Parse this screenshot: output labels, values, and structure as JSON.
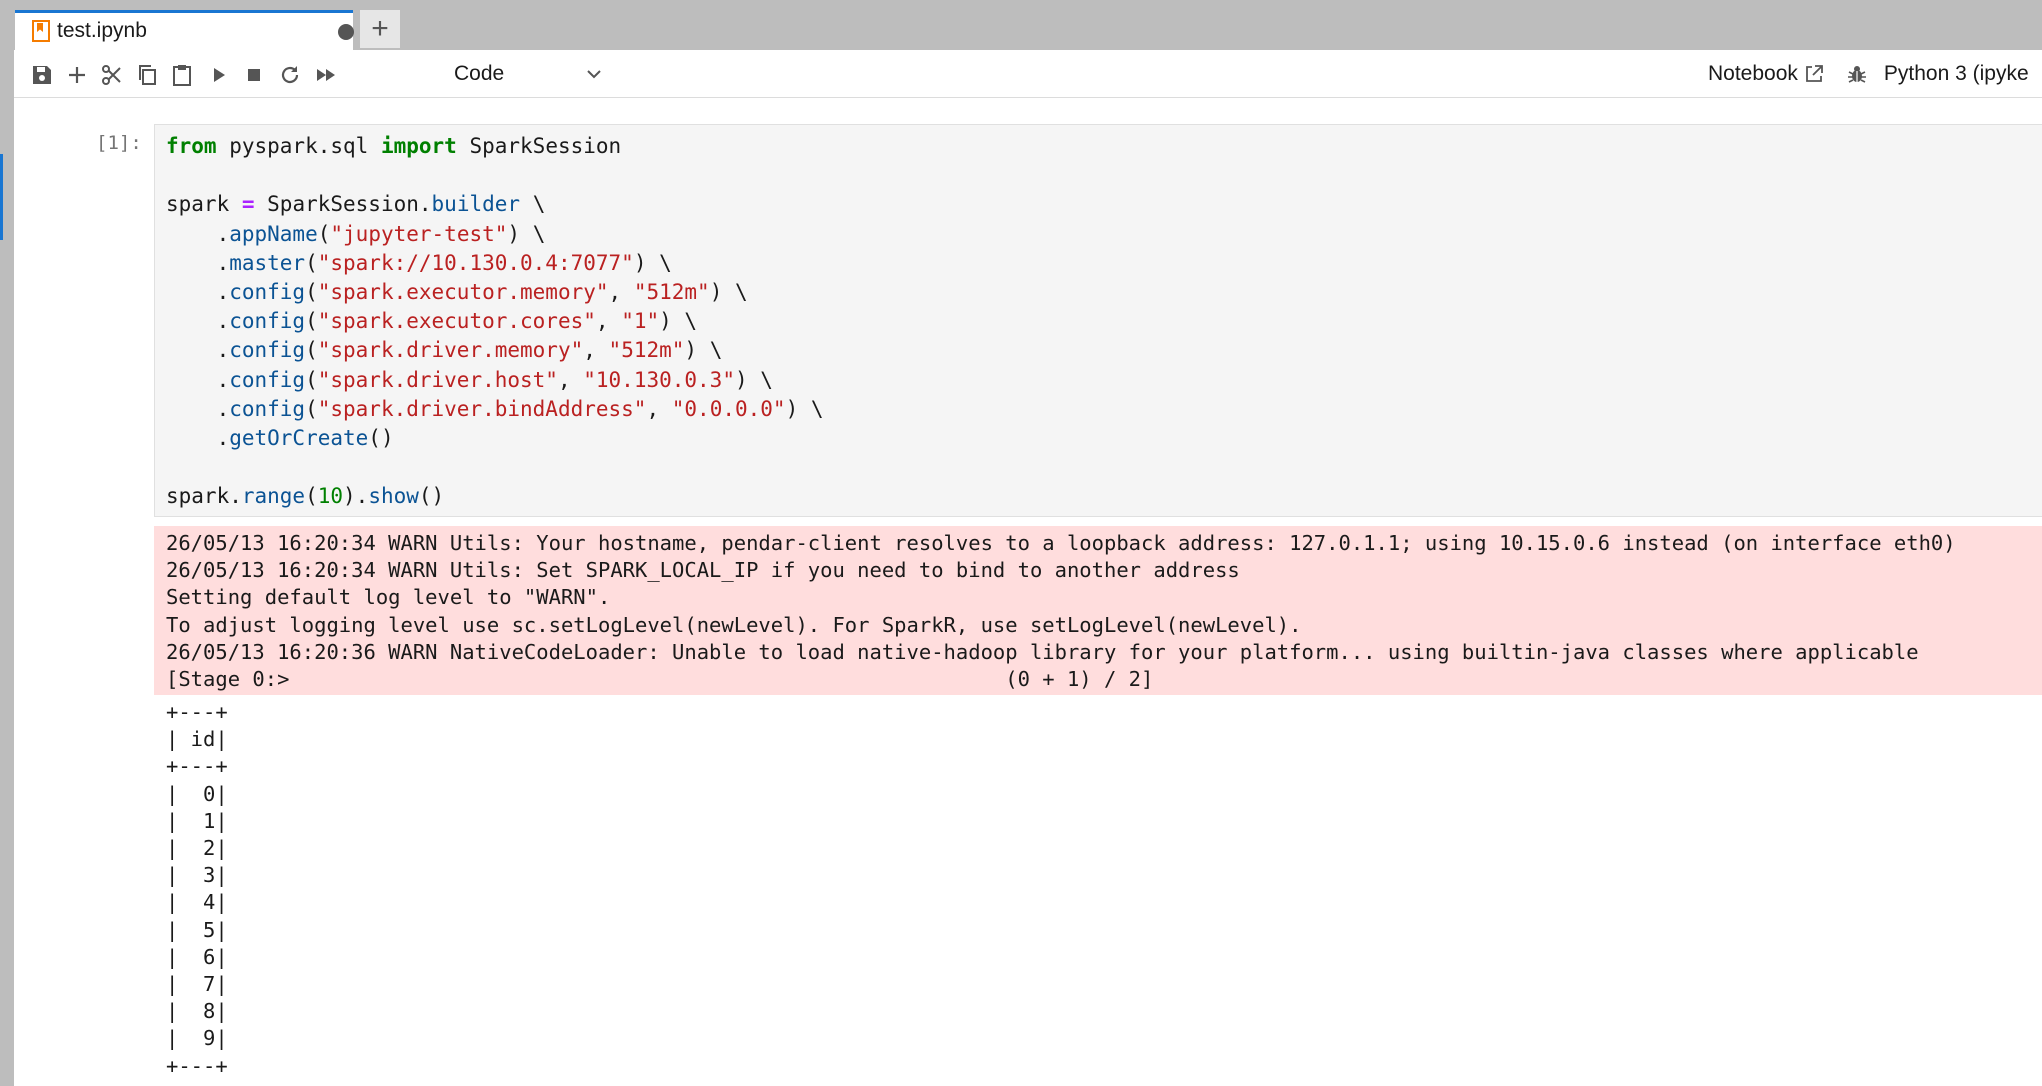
{
  "tab": {
    "title": "test.ipynb",
    "new_tab_label": "+",
    "icon": "notebook-icon",
    "unsaved_indicator": "dirty-dot"
  },
  "toolbar": {
    "buttons": [
      "save-icon",
      "insert-cell-icon",
      "cut-icon",
      "copy-icon",
      "paste-icon",
      "run-icon",
      "stop-icon",
      "restart-icon",
      "run-all-icon"
    ],
    "cell_type": "Code",
    "notebook_label": "Notebook",
    "kernel_name": "Python 3 (ipyke"
  },
  "cell": {
    "prompt": "[1]:",
    "code_lines": [
      "from pyspark.sql import SparkSession",
      "",
      "spark = SparkSession.builder \\",
      "    .appName(\"jupyter-test\") \\",
      "    .master(\"spark://10.130.0.4:7077\") \\",
      "    .config(\"spark.executor.memory\", \"512m\") \\",
      "    .config(\"spark.executor.cores\", \"1\") \\",
      "    .config(\"spark.driver.memory\", \"512m\") \\",
      "    .config(\"spark.driver.host\", \"10.130.0.3\") \\",
      "    .config(\"spark.driver.bindAddress\", \"0.0.0.0\") \\",
      "    .getOrCreate()",
      "",
      "spark.range(10).show()"
    ]
  },
  "stderr_lines": [
    "26/05/13 16:20:34 WARN Utils: Your hostname, pendar-client resolves to a loopback address: 127.0.1.1; using 10.15.0.6 instead (on interface eth0)",
    "26/05/13 16:20:34 WARN Utils: Set SPARK_LOCAL_IP if you need to bind to another address",
    "Setting default log level to \"WARN\".",
    "To adjust logging level use sc.setLogLevel(newLevel). For SparkR, use setLogLevel(newLevel).",
    "26/05/13 16:20:36 WARN NativeCodeLoader: Unable to load native-hadoop library for your platform... using builtin-java classes where applicable",
    "[Stage 0:>                                                          (0 + 1) / 2]"
  ],
  "stdout_lines": [
    "+---+",
    "| id|",
    "+---+",
    "|  0|",
    "|  1|",
    "|  2|",
    "|  3|",
    "|  4|",
    "|  5|",
    "|  6|",
    "|  7|",
    "|  8|",
    "|  9|",
    "+---+"
  ],
  "colors": {
    "stderr_background": "#ffdddd",
    "code_background": "#f5f5f5",
    "keyword": "#008000",
    "string": "#ba2121",
    "accent": "#1976d2"
  }
}
